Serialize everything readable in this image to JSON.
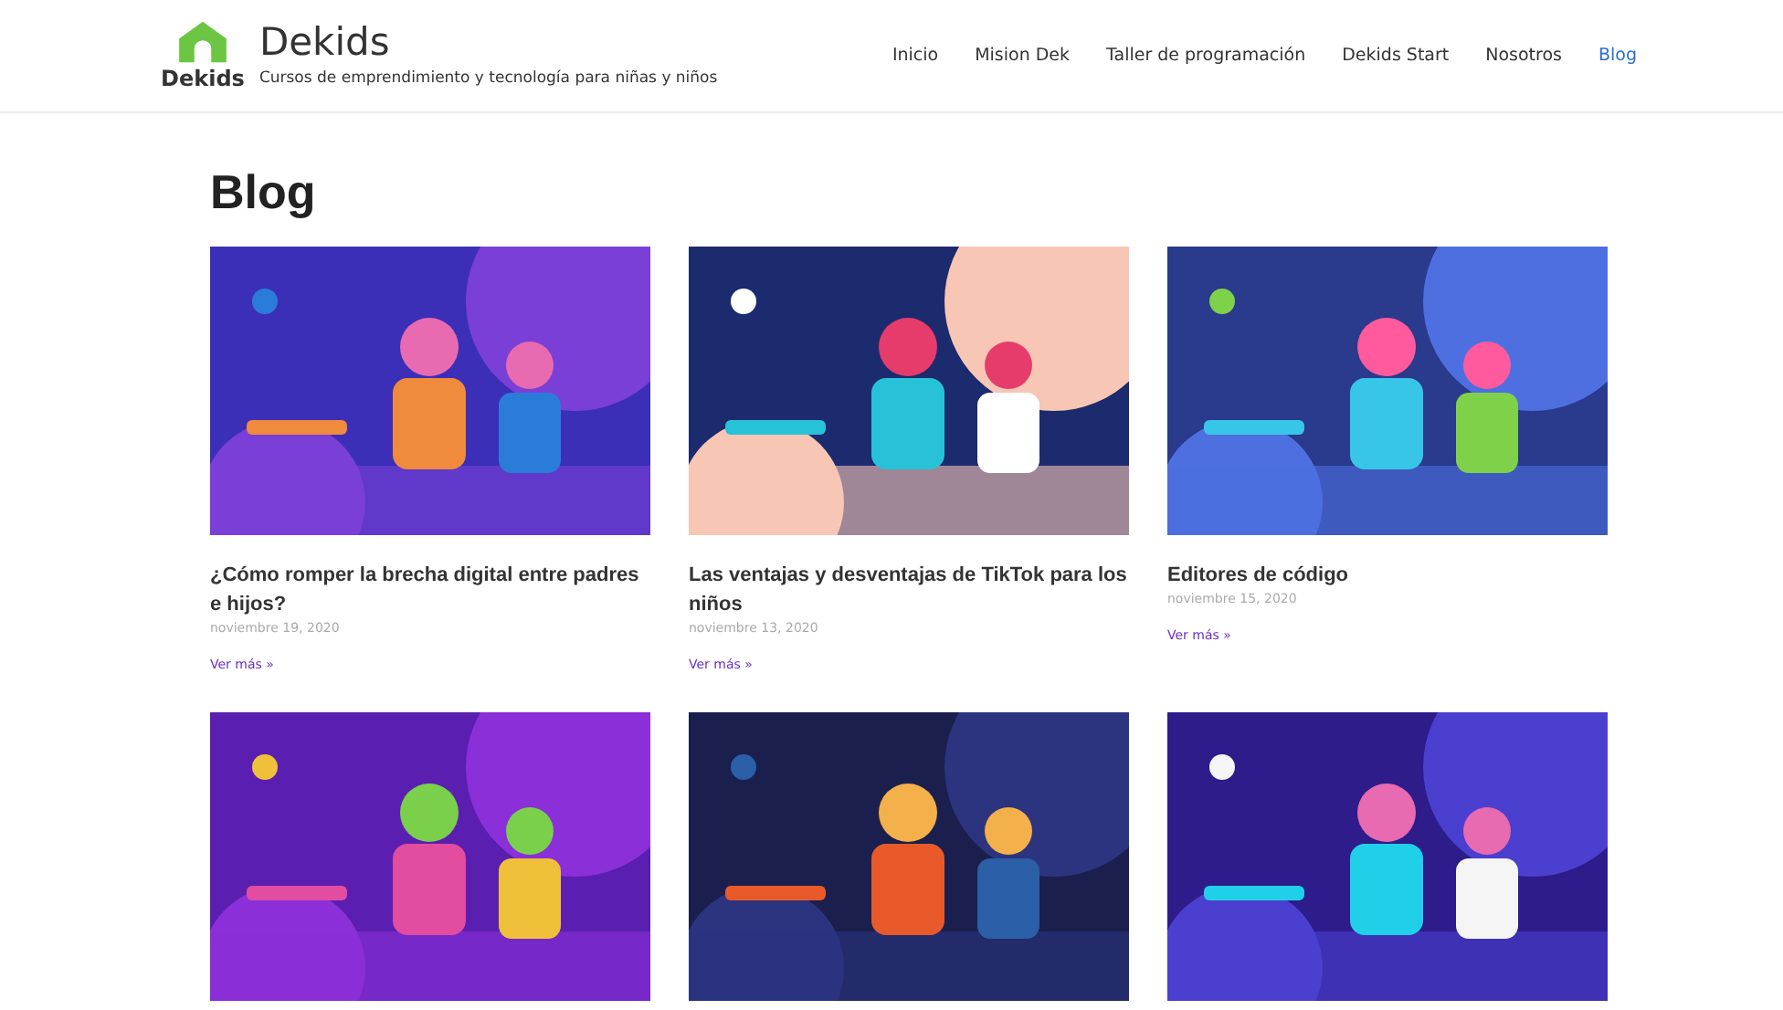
{
  "site": {
    "logo_text": "Dekids",
    "name": "Dekids",
    "tagline": "Cursos de emprendimiento y tecnología para niñas y niños"
  },
  "nav": [
    {
      "label": "Inicio",
      "selected": false
    },
    {
      "label": "Mision Dek",
      "selected": false
    },
    {
      "label": "Taller de programación",
      "selected": false
    },
    {
      "label": "Dekids Start",
      "selected": false
    },
    {
      "label": "Nosotros",
      "selected": false
    },
    {
      "label": "Blog",
      "selected": true
    }
  ],
  "page_title": "Blog",
  "posts": [
    {
      "image": {
        "kind": "picture"
      },
      "title": "¿Cómo romper la brecha digital entre padres e hijos?",
      "date": "noviembre 19, 2020",
      "link": "Ver más »"
    },
    {
      "image": {
        "kind": "picture"
      },
      "title": "Las ventajas y desventajas de TikTok para los niños",
      "date": "noviembre 13, 2020",
      "link": "Ver más »"
    },
    {
      "image": {
        "kind": "picture"
      },
      "title": "Editores de código",
      "date": "noviembre 15, 2020",
      "link": "Ver más »"
    },
    {
      "image": {
        "kind": "picture"
      }
    },
    {
      "image": {
        "kind": "picture"
      }
    },
    {
      "image": {
        "kind": "picture"
      }
    }
  ]
}
